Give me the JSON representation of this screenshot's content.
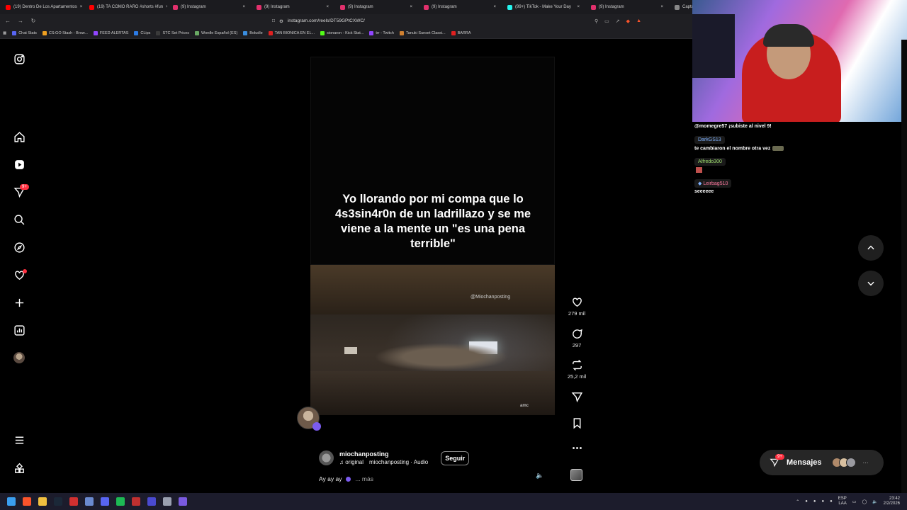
{
  "browser": {
    "tabs": [
      {
        "label": "(19) Dentro De Los Apartamentos",
        "color": "#ff0000"
      },
      {
        "label": "(19) TA COMO RARO #shorts #fun",
        "color": "#ff0000"
      },
      {
        "label": "(9) Instagram",
        "color": "#e1306c"
      },
      {
        "label": "(9) Instagram",
        "color": "#e1306c"
      },
      {
        "label": "(9) Instagram",
        "color": "#e1306c"
      },
      {
        "label": "(9) Instagram",
        "color": "#e1306c"
      },
      {
        "label": "(99+) TikTok - Make Your Day",
        "color": "#25f4ee"
      },
      {
        "label": "(9) Instagram",
        "color": "#e1306c"
      },
      {
        "label": "Captur",
        "color": "#888888"
      }
    ],
    "url": "instagram.com/reels/DT59GPtCXWC/",
    "bookmarks": [
      {
        "label": "Chat Stats",
        "color": "#5865f2"
      },
      {
        "label": "CS:GO Stash - Brow...",
        "color": "#f0a020"
      },
      {
        "label": "FEED ALERTAS",
        "color": "#9146ff"
      },
      {
        "label": "CLips",
        "color": "#2c7be5"
      },
      {
        "label": "STC Set Prices",
        "color": "#3a3a3a"
      },
      {
        "label": "Wordle Español (ES)",
        "color": "#6aaa64"
      },
      {
        "label": "Boludle",
        "color": "#3a8dde"
      },
      {
        "label": "TAN BIONICA EN EL...",
        "color": "#e02020"
      },
      {
        "label": "sionaron - Kick Stat...",
        "color": "#53fc18"
      },
      {
        "label": "trr - Twitch",
        "color": "#9146ff"
      },
      {
        "label": "Tanuki Sunset Classi...",
        "color": "#d08030"
      },
      {
        "label": "BARRA",
        "color": "#e02020"
      }
    ]
  },
  "sidebar": {
    "notifications_badge": "9+"
  },
  "reel": {
    "overlay_text": "Yo llorando por mi compa que lo 4s3sin4r0n de un ladrillazo y se me viene a la mente un \"es una pena terrible\"",
    "watermark": "@Miochanposting",
    "network_logo": "amc",
    "username": "miochanposting",
    "audio_original": "original",
    "audio_name": "miochanposting · Audio",
    "follow_label": "Seguir",
    "caption": "Ay ay ay",
    "more_label": "... más"
  },
  "actions": {
    "likes": "279 mil",
    "comments": "297",
    "reposts": "25,2 mil"
  },
  "messages": {
    "label": "Mensajes",
    "badge": "9+"
  },
  "stream_chat": {
    "lines": [
      {
        "user": "",
        "text": "@momegre57 ¡subiste al nivel 9!"
      },
      {
        "user": "DarkGS13",
        "text": "te cambiaron el nombre otra vez"
      },
      {
        "user": "Alfredo300",
        "text": ""
      },
      {
        "user": "Leirbag510",
        "text": "seeeeee"
      }
    ],
    "user_colors": [
      "#7fb2ff",
      "#a0e070",
      "#ff7aa0"
    ]
  },
  "taskbar": {
    "lang": "ESP",
    "layout": "LAA",
    "time": "23:42",
    "date": "2/2/2026"
  }
}
